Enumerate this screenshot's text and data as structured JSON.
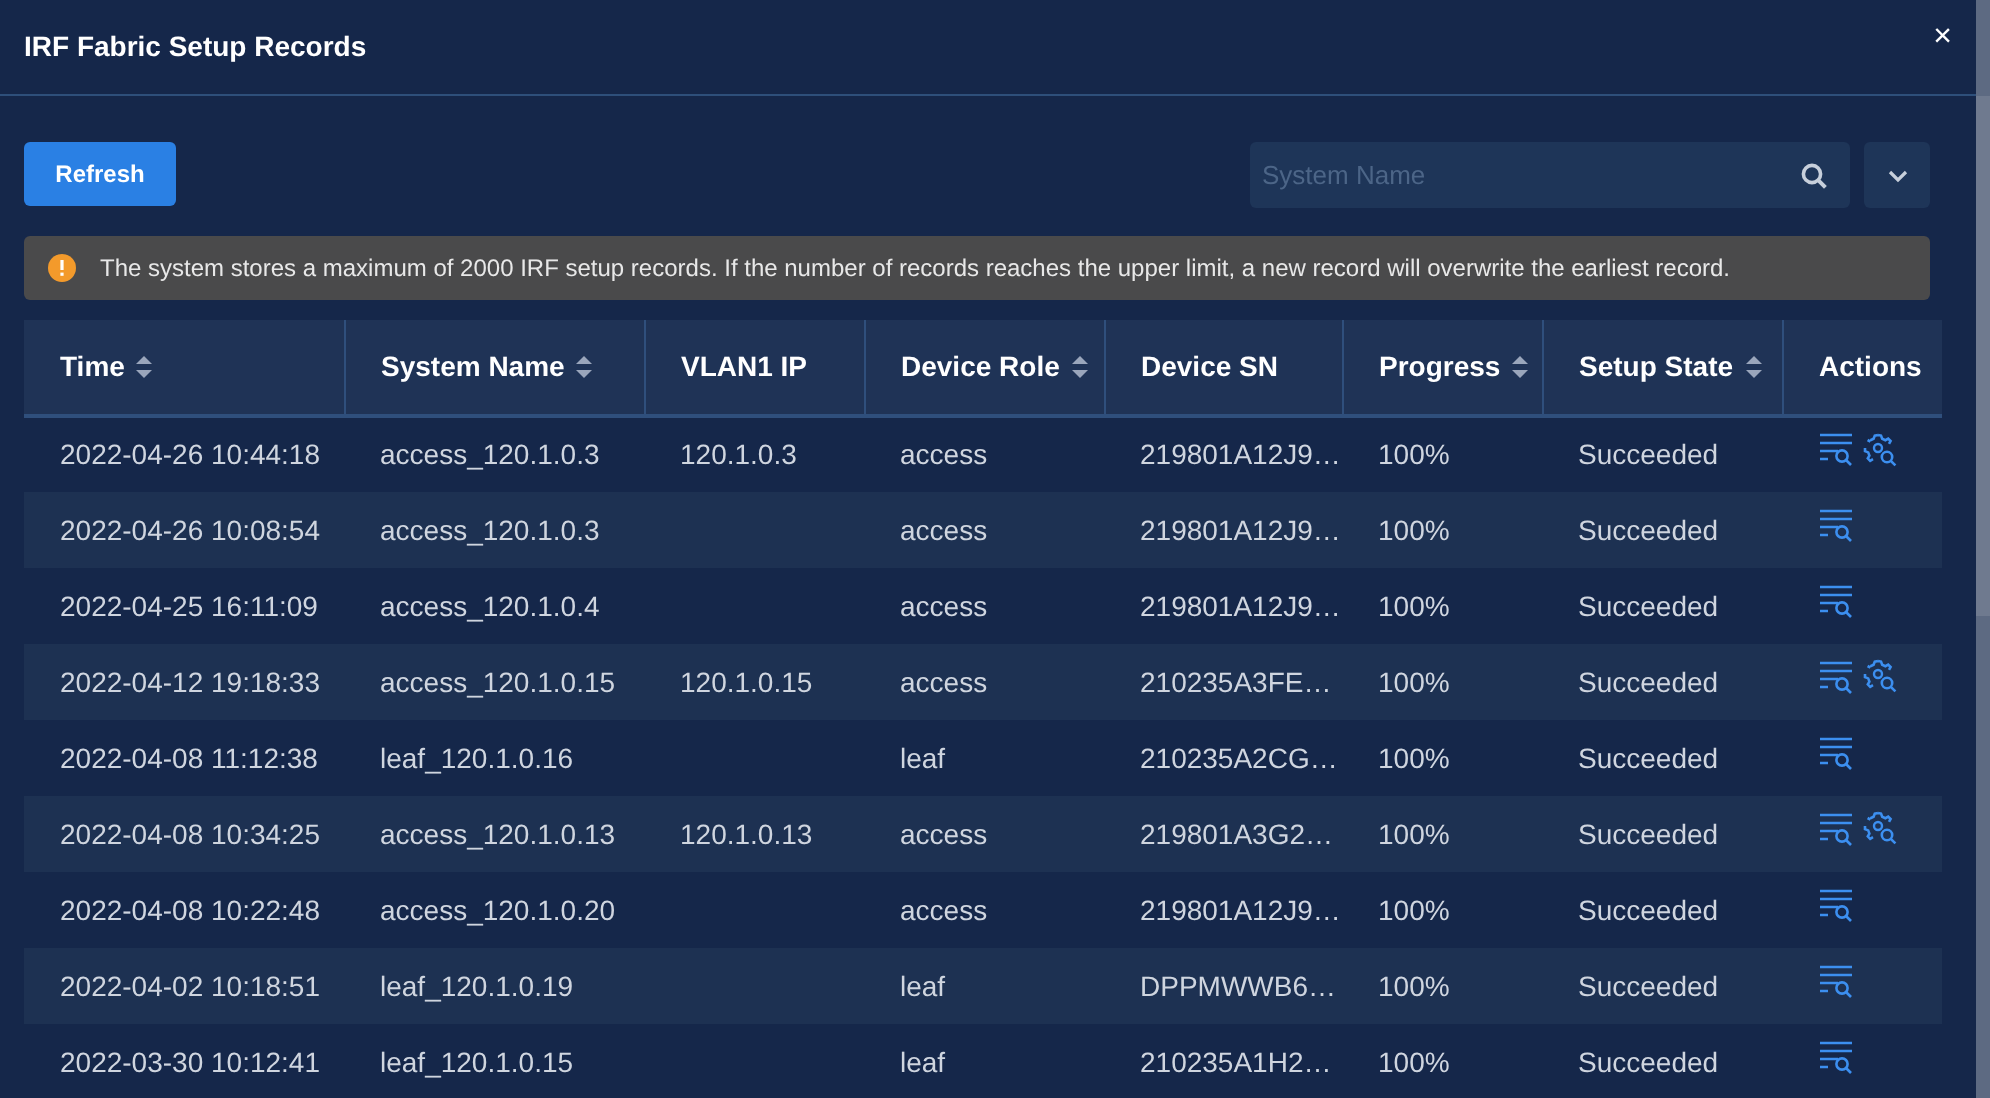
{
  "dialog": {
    "title": "IRF Fabric Setup Records",
    "close": "×"
  },
  "toolbar": {
    "refresh": "Refresh",
    "search": {
      "placeholder": "System Name"
    }
  },
  "notice": {
    "text": "The system stores a maximum of 2000 IRF setup records. If the number of records reaches the upper limit, a new record will overwrite the earliest record."
  },
  "table": {
    "columns": [
      {
        "label": "Time",
        "sortable": true
      },
      {
        "label": "System Name",
        "sortable": true
      },
      {
        "label": "VLAN1 IP",
        "sortable": false
      },
      {
        "label": "Device Role",
        "sortable": true
      },
      {
        "label": "Device SN",
        "sortable": false
      },
      {
        "label": "Progress",
        "sortable": true
      },
      {
        "label": "Setup State",
        "sortable": true
      },
      {
        "label": "Actions",
        "sortable": false
      }
    ],
    "rows": [
      {
        "cells": [
          "2022-04-26 10:44:18",
          "access_120.1.0.3",
          "120.1.0.3",
          "access",
          "219801A12J9…",
          "100%",
          "Succeeded"
        ],
        "actions": [
          {
            "kind": "log"
          },
          {
            "kind": "config"
          }
        ]
      },
      {
        "cells": [
          "2022-04-26 10:08:54",
          "access_120.1.0.3",
          "",
          "access",
          "219801A12J9…",
          "100%",
          "Succeeded"
        ],
        "actions": [
          {
            "kind": "log"
          }
        ]
      },
      {
        "cells": [
          "2022-04-25 16:11:09",
          "access_120.1.0.4",
          "",
          "access",
          "219801A12J9…",
          "100%",
          "Succeeded"
        ],
        "actions": [
          {
            "kind": "log"
          }
        ]
      },
      {
        "cells": [
          "2022-04-12 19:18:33",
          "access_120.1.0.15",
          "120.1.0.15",
          "access",
          "210235A3FE…",
          "100%",
          "Succeeded"
        ],
        "actions": [
          {
            "kind": "log"
          },
          {
            "kind": "config"
          }
        ]
      },
      {
        "cells": [
          "2022-04-08 11:12:38",
          "leaf_120.1.0.16",
          "",
          "leaf",
          "210235A2CG…",
          "100%",
          "Succeeded"
        ],
        "actions": [
          {
            "kind": "log"
          }
        ]
      },
      {
        "cells": [
          "2022-04-08 10:34:25",
          "access_120.1.0.13",
          "120.1.0.13",
          "access",
          "219801A3G2…",
          "100%",
          "Succeeded"
        ],
        "actions": [
          {
            "kind": "log"
          },
          {
            "kind": "config"
          }
        ]
      },
      {
        "cells": [
          "2022-04-08 10:22:48",
          "access_120.1.0.20",
          "",
          "access",
          "219801A12J9…",
          "100%",
          "Succeeded"
        ],
        "actions": [
          {
            "kind": "log"
          }
        ]
      },
      {
        "cells": [
          "2022-04-02 10:18:51",
          "leaf_120.1.0.19",
          "",
          "leaf",
          "DPPMWWB6…",
          "100%",
          "Succeeded"
        ],
        "actions": [
          {
            "kind": "log"
          }
        ]
      },
      {
        "cells": [
          "2022-03-30 10:12:41",
          "leaf_120.1.0.15",
          "",
          "leaf",
          "210235A1H2…",
          "100%",
          "Succeeded"
        ],
        "actions": [
          {
            "kind": "log"
          }
        ]
      }
    ]
  }
}
